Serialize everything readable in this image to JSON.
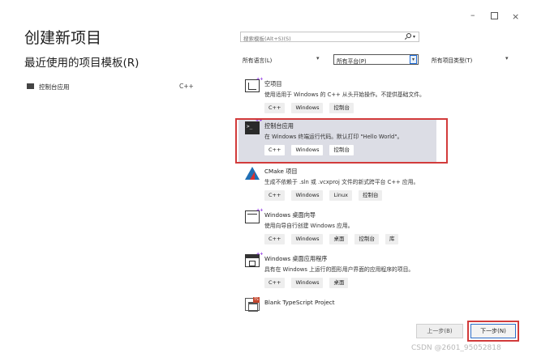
{
  "window": {
    "title": "创建新项目",
    "controls": {
      "minimize": "–",
      "close": "×"
    }
  },
  "left": {
    "recent_heading": "最近使用的项目模板(R)",
    "recent_items": [
      {
        "label": "控制台应用",
        "lang": "C++"
      }
    ]
  },
  "search": {
    "placeholder": "搜索模板(Alt+S)(S)"
  },
  "filters": {
    "language": "所有语言(L)",
    "platform": "所有平台(P)",
    "project_type": "所有项目类型(T)"
  },
  "templates": [
    {
      "name": "空项目",
      "desc": "使用适用于 Windows 的 C++ 从头开始操作。不提供基础文件。",
      "tags": [
        "C++",
        "Windows",
        "控制台"
      ],
      "icon": "empty-project-icon"
    },
    {
      "name": "控制台应用",
      "desc": "在 Windows 终端运行代码。默认打印 \"Hello World\"。",
      "tags": [
        "C++",
        "Windows",
        "控制台"
      ],
      "icon": "console-app-icon",
      "selected": true
    },
    {
      "name": "CMake 项目",
      "desc": "生成不依赖于 .sln 或 .vcxproj 文件的新式跨平台 C++ 应用。",
      "tags": [
        "C++",
        "Windows",
        "Linux",
        "控制台"
      ],
      "icon": "cmake-icon"
    },
    {
      "name": "Windows 桌面向导",
      "desc": "使用向导自行创建 Windows 应用。",
      "tags": [
        "C++",
        "Windows",
        "桌面",
        "控制台",
        "库"
      ],
      "icon": "desktop-wizard-icon"
    },
    {
      "name": "Windows 桌面应用程序",
      "desc": "具有在 Windows 上运行的图形用户界面的应用程序的项目。",
      "tags": [
        "C++",
        "Windows",
        "桌面"
      ],
      "icon": "desktop-app-icon"
    },
    {
      "name": "Blank TypeScript Project",
      "desc": "",
      "tags": [],
      "icon": "typescript-project-icon"
    }
  ],
  "buttons": {
    "back": "上一步(B)",
    "next": "下一步(N)"
  },
  "watermark": "CSDN @2601_95052818",
  "colors": {
    "selection_bg": "#dcdde5",
    "highlight_border": "#d23b3b",
    "accent": "#2d6ec9"
  }
}
